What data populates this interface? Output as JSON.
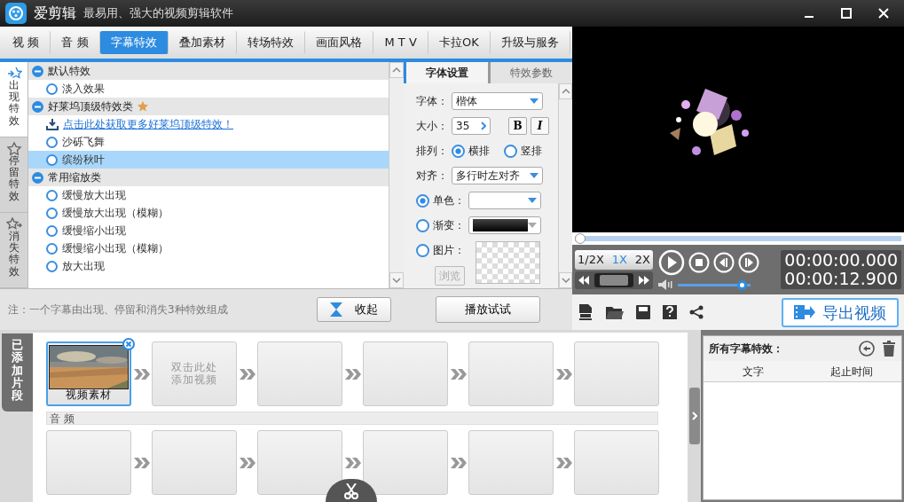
{
  "window": {
    "title": "爱剪辑",
    "subtitle": "最易用、强大的视频剪辑软件"
  },
  "tabs": [
    {
      "label": "视 频",
      "selected": false
    },
    {
      "label": "音 频",
      "selected": false
    },
    {
      "label": "字幕特效",
      "selected": true
    },
    {
      "label": "叠加素材",
      "selected": false
    },
    {
      "label": "转场特效",
      "selected": false
    },
    {
      "label": "画面风格",
      "selected": false
    },
    {
      "label": "M T V",
      "selected": false
    },
    {
      "label": "卡拉OK",
      "selected": false
    },
    {
      "label": "升级与服务",
      "selected": false
    }
  ],
  "effect_types": [
    {
      "label": "出现特效",
      "kind": "in",
      "selected": true
    },
    {
      "label": "停留特效",
      "kind": "stay",
      "selected": false
    },
    {
      "label": "消失特效",
      "kind": "out",
      "selected": false
    }
  ],
  "effect_groups": [
    {
      "label": "默认特效",
      "expanded": true,
      "starred": false,
      "items": [
        {
          "kind": "option",
          "label": "淡入效果",
          "selected": false
        }
      ]
    },
    {
      "label": "好莱坞顶级特效类",
      "expanded": true,
      "starred": true,
      "items": [
        {
          "kind": "link",
          "label": "点击此处获取更多好莱坞顶级特效！"
        },
        {
          "kind": "option",
          "label": "沙砾飞舞",
          "selected": false
        },
        {
          "kind": "option",
          "label": "缤纷秋叶",
          "selected": true
        }
      ]
    },
    {
      "label": "常用缩放类",
      "expanded": true,
      "starred": false,
      "items": [
        {
          "kind": "option",
          "label": "缓慢放大出现",
          "selected": false
        },
        {
          "kind": "option",
          "label": "缓慢放大出现（模糊）",
          "selected": false
        },
        {
          "kind": "option",
          "label": "缓慢缩小出现",
          "selected": false
        },
        {
          "kind": "option",
          "label": "缓慢缩小出现（模糊）",
          "selected": false
        },
        {
          "kind": "option",
          "label": "放大出现",
          "selected": false
        }
      ]
    }
  ],
  "note": "注：一个字幕由出现、停留和消失3种特效组成",
  "collapse_button": "收起",
  "settings_tabs": [
    {
      "label": "字体设置",
      "selected": true
    },
    {
      "label": "特效参数",
      "selected": false
    }
  ],
  "font": {
    "label": "字体：",
    "value": "楷体"
  },
  "size": {
    "label": "大小：",
    "value": "35"
  },
  "bold_button": "B",
  "italic_button": "I",
  "arrangement": {
    "label": "排列：",
    "options": [
      {
        "label": "横排",
        "selected": true
      },
      {
        "label": "竖排",
        "selected": false
      }
    ]
  },
  "align": {
    "label": "对齐：",
    "value": "多行时左对齐"
  },
  "color_modes": [
    {
      "kind": "solid",
      "label": "单色：",
      "selected": true
    },
    {
      "kind": "gradient",
      "label": "渐变：",
      "selected": false
    },
    {
      "label": "图片：",
      "selected": false
    }
  ],
  "browse_button": {
    "label": "浏览",
    "disabled": true
  },
  "play_button": "播放试试",
  "player": {
    "progress": {
      "level": 0
    },
    "speeds": [
      {
        "label": "1/2X",
        "selected": false
      },
      {
        "label": "1X",
        "selected": true
      },
      {
        "label": "2X",
        "selected": false
      }
    ],
    "volume": {
      "level": 0.95
    },
    "current_time": "00:00:00.000",
    "total_time": "00:00:12.900"
  },
  "export_button": "导出视频",
  "clips_tab": "已添加片段",
  "video_clips": [
    {
      "kind": "clip",
      "label": "视频素材",
      "selected": true
    },
    {
      "kind": "add",
      "label": "双击此处添加视频"
    },
    {
      "kind": "empty"
    },
    {
      "kind": "empty"
    },
    {
      "kind": "empty"
    },
    {
      "kind": "empty"
    }
  ],
  "audio_label": "音 频",
  "audio_clips": [
    {
      "kind": "empty"
    },
    {
      "kind": "empty"
    },
    {
      "kind": "empty"
    },
    {
      "kind": "empty"
    },
    {
      "kind": "empty"
    },
    {
      "kind": "empty"
    }
  ],
  "subtitle_panel": {
    "title": "所有字幕特效：",
    "columns": [
      "文字",
      "起止时间"
    ]
  }
}
